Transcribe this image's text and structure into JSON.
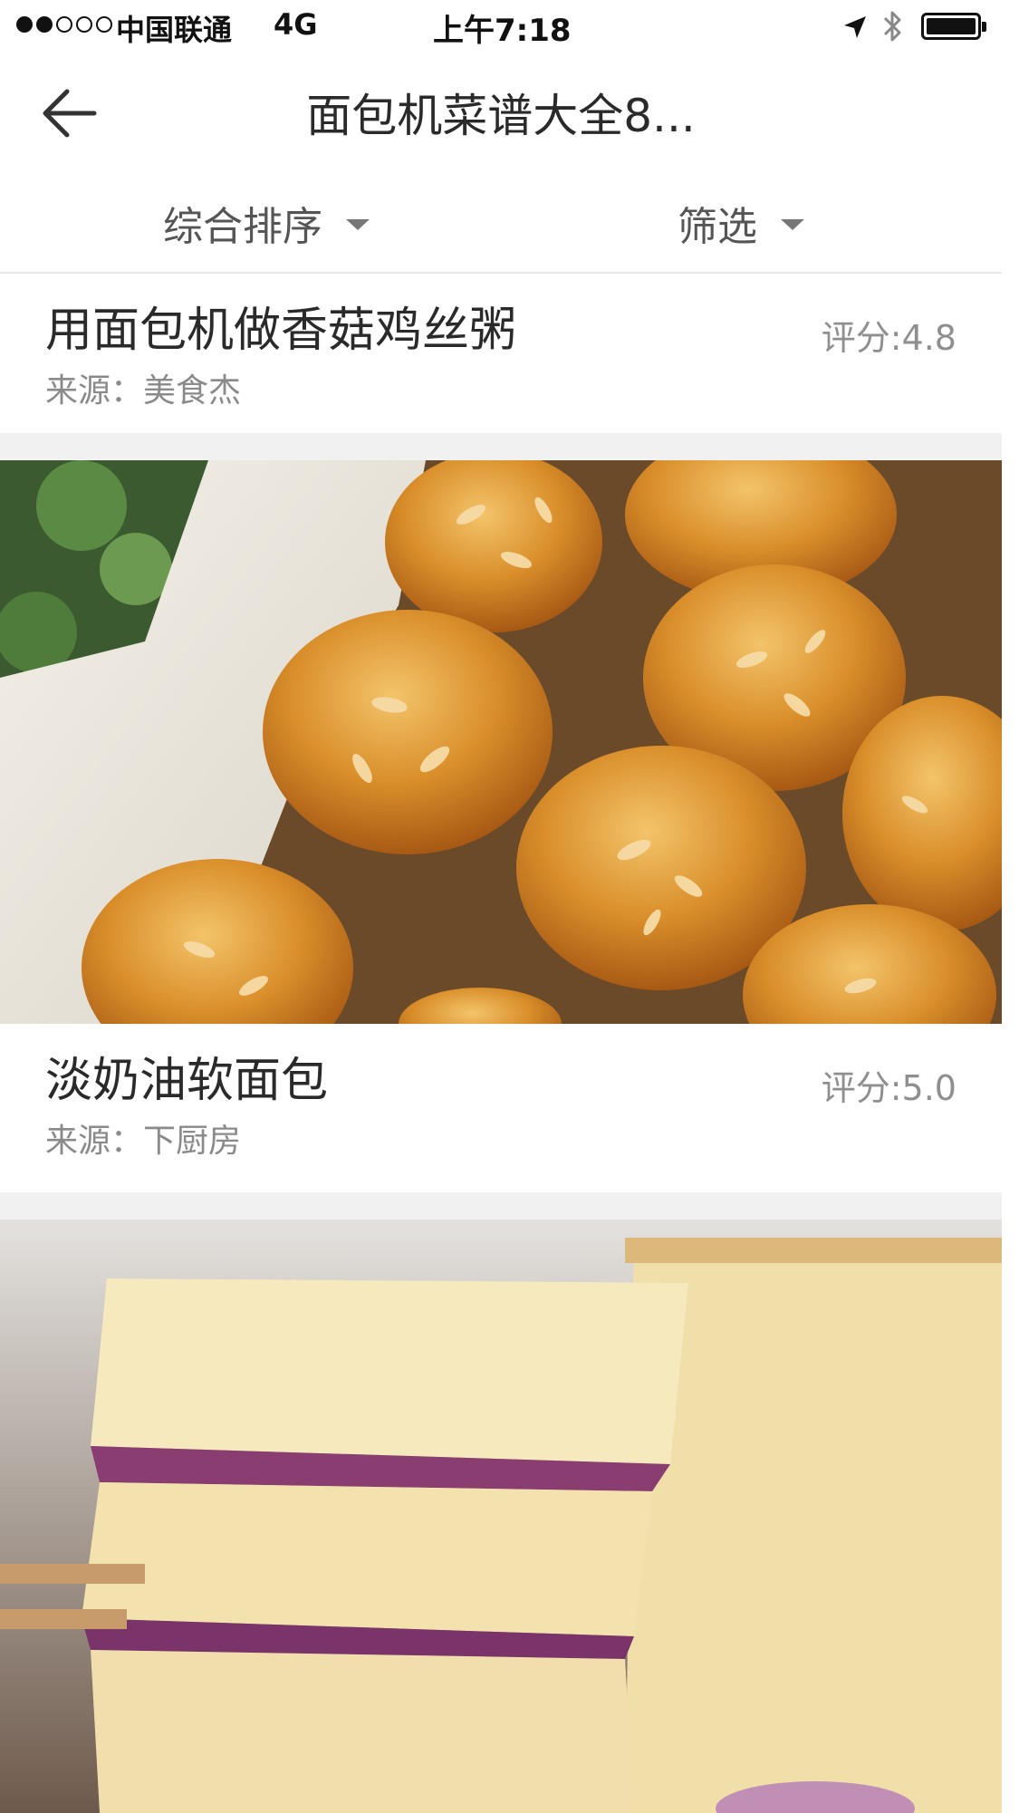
{
  "status_bar": {
    "carrier": "中国联通",
    "network": "4G",
    "time": "上午7:18"
  },
  "nav": {
    "title": "面包机菜谱大全8..."
  },
  "filters": {
    "sort_label": "综合排序",
    "filter_label": "筛选"
  },
  "recipes": [
    {
      "title": "用面包机做香菇鸡丝粥",
      "source": "来源：美食杰",
      "rating": "评分:4.8"
    },
    {
      "title": "淡奶油软面包",
      "source": "来源：下厨房",
      "rating": "评分:5.0"
    }
  ],
  "colors": {
    "background": "#ffffff",
    "divider": "#f1f1f1",
    "title_text": "#2a2a2a",
    "secondary_text": "#8a8a8a"
  }
}
